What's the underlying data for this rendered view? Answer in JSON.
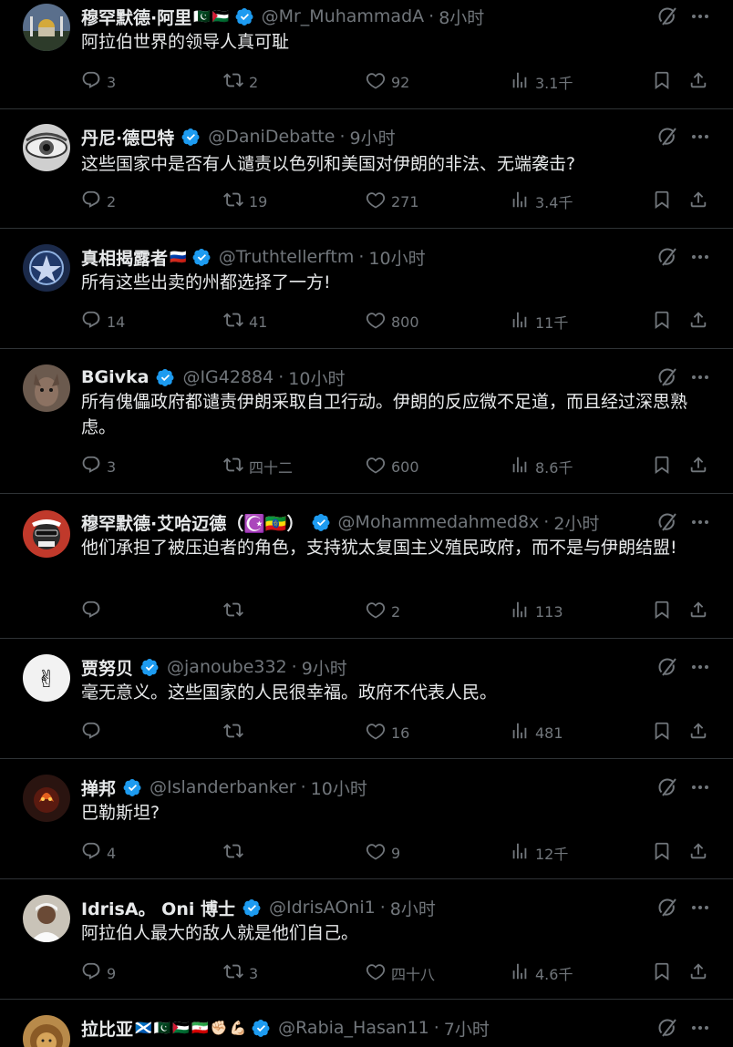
{
  "tweets": [
    {
      "name": "穆罕默德·阿里",
      "flags": [
        "🇵🇰",
        "🇵🇸"
      ],
      "handle": "@Mr_MuhammadA",
      "time": "8小时",
      "text": "阿拉伯世界的领导人真可耻",
      "replies": "3",
      "retweets": "2",
      "likes": "92",
      "views": "3.1千",
      "avatar_icon": "mosque-avatar",
      "avatar_color": "#5a6f8c"
    },
    {
      "name": "丹尼·德巴特",
      "flags": [],
      "handle": "@DaniDebatte",
      "time": "9小时",
      "text": "这些国家中是否有人谴责以色列和美国对伊朗的非法、无端袭击?",
      "replies": "2",
      "retweets": "19",
      "likes": "271",
      "views": "3.4千",
      "avatar_icon": "eye-avatar",
      "avatar_color": "#8a8a8a"
    },
    {
      "name": "真相揭露者",
      "flags": [
        "🇷🇺"
      ],
      "handle": "@Truthtellerftm",
      "time": "10小时",
      "text": "所有这些出卖的州都选择了一方!",
      "replies": "14",
      "retweets": "41",
      "likes": "800",
      "views": "11千",
      "avatar_icon": "emblem-avatar",
      "avatar_color": "#1b2a4a"
    },
    {
      "name": "BGivka",
      "flags": [],
      "handle": "@IG42884",
      "time": "10小时",
      "text": "所有傀儡政府都谴责伊朗采取自卫行动。伊朗的反应微不足道，而且经过深思熟虑。",
      "replies": "3",
      "retweets": "四十二",
      "likes": "600",
      "views": "8.6千",
      "avatar_icon": "creature-avatar",
      "avatar_color": "#6b5a4e"
    },
    {
      "name": "穆罕默德·艾哈迈德（☪️🇪🇹）",
      "flags": [],
      "handle": "@Mohammedahmed8x",
      "time": "2小时",
      "text": "他们承担了被压迫者的角色，支持犹太复国主义殖民政府，而不是与伊朗结盟!",
      "replies": "",
      "retweets": "",
      "likes": "2",
      "views": "113",
      "avatar_icon": "portrait-avatar",
      "avatar_color": "#c0392b"
    },
    {
      "name": "贾努贝",
      "flags": [],
      "handle": "@janoube332",
      "time": "9小时",
      "text": "毫无意义。这些国家的人民很幸福。政府不代表人民。",
      "replies": "",
      "retweets": "",
      "likes": "16",
      "views": "481",
      "avatar_icon": "victory-hand-avatar",
      "avatar_color": "#f2f2f2"
    },
    {
      "name": "掸邦",
      "flags": [],
      "handle": "@Islanderbanker",
      "time": "10小时",
      "text": "巴勒斯坦?",
      "replies": "4",
      "retweets": "",
      "likes": "9",
      "views": "12千",
      "avatar_icon": "fire-avatar",
      "avatar_color": "#2a1410"
    },
    {
      "name": "IdrisA。 Oni 博士",
      "flags": [],
      "handle": "@IdrisAOni1",
      "time": "8小时",
      "text": "阿拉伯人最大的敌人就是他们自己。",
      "replies": "9",
      "retweets": "3",
      "likes": "四十八",
      "views": "4.6千",
      "avatar_icon": "man-avatar",
      "avatar_color": "#c9c3b8"
    },
    {
      "name": "拉比亚",
      "flags": [
        "🏴󠁧󠁢󠁳󠁣󠁴󠁿",
        "🇵🇰",
        "🇵🇸",
        "🇮🇷",
        "✊🏻",
        "💪🏻"
      ],
      "handle": "@Rabia_Hasan11",
      "time": "7小时",
      "text": "",
      "replies": "",
      "retweets": "",
      "likes": "",
      "views": "",
      "avatar_icon": "lion-avatar",
      "avatar_color": "#b88a4a"
    }
  ],
  "colors": {
    "background": "#000000",
    "text": "#e7e9ea",
    "muted": "#71767b",
    "verified": "#1d9bf0",
    "divider": "#2f3336"
  }
}
